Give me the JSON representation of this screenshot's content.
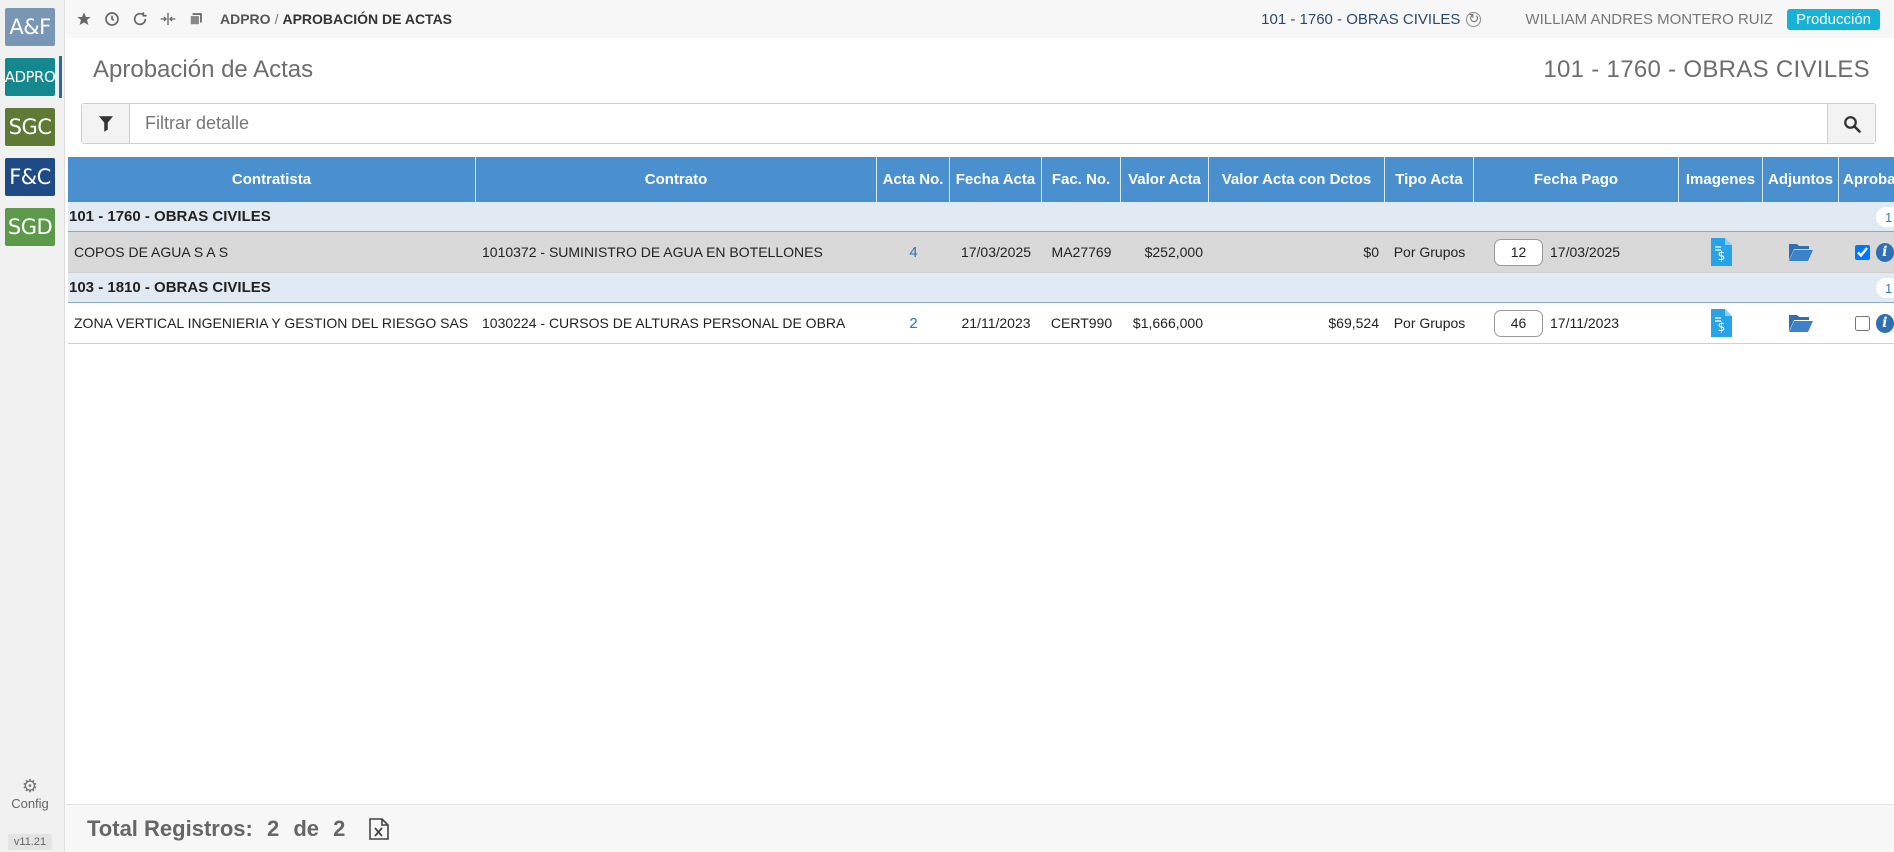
{
  "rail": {
    "apps": [
      {
        "label": "A&F",
        "color": "#7a96b6"
      },
      {
        "label": "ADPRO",
        "color": "#14888f"
      },
      {
        "label": "SGC",
        "color": "#5f7a35"
      },
      {
        "label": "F&C",
        "color": "#1e4a86"
      },
      {
        "label": "SGD",
        "color": "#5c9a4a"
      }
    ],
    "config_label": "Config",
    "version": "v11.21"
  },
  "topbar": {
    "breadcrumb_root": "ADPRO",
    "breadcrumb_separator": "/",
    "breadcrumb_current": "APROBACIÓN DE ACTAS",
    "context": "101 - 1760 - OBRAS CIVILES",
    "user": "WILLIAM ANDRES MONTERO RUIZ",
    "environment": "Producción"
  },
  "page": {
    "title": "Aprobación de Actas",
    "context": "101 - 1760 - OBRAS CIVILES"
  },
  "filter": {
    "placeholder": "Filtrar detalle",
    "value": ""
  },
  "grid": {
    "columns": [
      "Contratista",
      "Contrato",
      "Acta No.",
      "Fecha Acta",
      "Fac. No.",
      "Valor Acta",
      "Valor Acta con Dctos",
      "Tipo Acta",
      "Fecha Pago",
      "Imagenes",
      "Adjuntos",
      "Aprobar"
    ],
    "groups": [
      {
        "title": "101 - 1760 - OBRAS CIVILES",
        "count": "1",
        "row": {
          "contratista": "COPOS DE AGUA S A S",
          "contrato": "1010372 - SUMINISTRO DE AGUA EN BOTELLONES",
          "acta_no": "4",
          "fecha_acta": "17/03/2025",
          "fac_no": "MA27769",
          "valor_acta": "$252,000",
          "valor_dctos": "$0",
          "tipo_acta": "Por Grupos",
          "dias": "12",
          "fecha_pago": "17/03/2025",
          "aprobado": true
        }
      },
      {
        "title": "103 - 1810 - OBRAS CIVILES",
        "count": "1",
        "row": {
          "contratista": "ZONA VERTICAL INGENIERIA Y GESTION DEL RIESGO SAS",
          "contrato": "1030224 - CURSOS DE ALTURAS PERSONAL DE OBRA",
          "acta_no": "2",
          "fecha_acta": "21/11/2023",
          "fac_no": "CERT990",
          "valor_acta": "$1,666,000",
          "valor_dctos": "$69,524",
          "tipo_acta": "Por Grupos",
          "dias": "46",
          "fecha_pago": "17/11/2023",
          "aprobado": false
        }
      }
    ]
  },
  "footer": {
    "label": "Total Registros:",
    "shown": "2",
    "of": "de",
    "total": "2"
  }
}
